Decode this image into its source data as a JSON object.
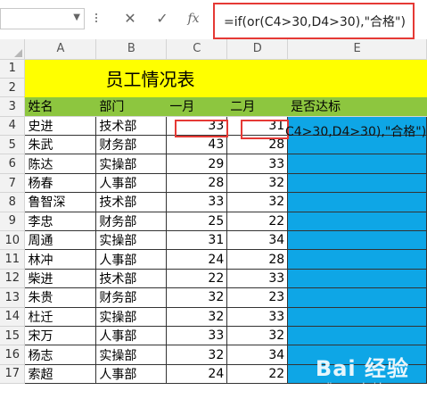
{
  "formula_bar": {
    "name_box": "",
    "cancel_icon": "close-icon",
    "enter_icon": "check-icon",
    "fx_label": "fx",
    "formula": "=if(or(C4>30,D4>30),\"合格\")"
  },
  "columns": [
    "A",
    "B",
    "C",
    "D",
    "E"
  ],
  "rows": [
    "1",
    "2",
    "3",
    "4",
    "5",
    "6",
    "7",
    "8",
    "9",
    "10",
    "11",
    "12",
    "13",
    "14",
    "15",
    "16",
    "17",
    "18"
  ],
  "title": "员工情况表",
  "headers": {
    "name": "姓名",
    "dept": "部门",
    "jan": "一月",
    "feb": "二月",
    "result": "是否达标"
  },
  "records": [
    {
      "name": "史进",
      "dept": "技术部",
      "jan": "33",
      "feb": "31",
      "result": "C4>30,D4>30),\"合格\")"
    },
    {
      "name": "朱武",
      "dept": "财务部",
      "jan": "43",
      "feb": "28",
      "result": ""
    },
    {
      "name": "陈达",
      "dept": "实操部",
      "jan": "29",
      "feb": "33",
      "result": ""
    },
    {
      "name": "杨春",
      "dept": "人事部",
      "jan": "28",
      "feb": "32",
      "result": ""
    },
    {
      "name": "鲁智深",
      "dept": "技术部",
      "jan": "33",
      "feb": "32",
      "result": ""
    },
    {
      "name": "李忠",
      "dept": "财务部",
      "jan": "25",
      "feb": "22",
      "result": ""
    },
    {
      "name": "周通",
      "dept": "实操部",
      "jan": "31",
      "feb": "34",
      "result": ""
    },
    {
      "name": "林冲",
      "dept": "人事部",
      "jan": "24",
      "feb": "28",
      "result": ""
    },
    {
      "name": "柴进",
      "dept": "技术部",
      "jan": "22",
      "feb": "33",
      "result": ""
    },
    {
      "name": "朱贵",
      "dept": "财务部",
      "jan": "32",
      "feb": "23",
      "result": ""
    },
    {
      "name": "杜迁",
      "dept": "实操部",
      "jan": "32",
      "feb": "33",
      "result": ""
    },
    {
      "name": "宋万",
      "dept": "人事部",
      "jan": "33",
      "feb": "32",
      "result": ""
    },
    {
      "name": "杨志",
      "dept": "实操部",
      "jan": "32",
      "feb": "34",
      "result": ""
    },
    {
      "name": "索超",
      "dept": "人事部",
      "jan": "24",
      "feb": "22",
      "result": ""
    }
  ],
  "colors": {
    "title_fill": "#ffff00",
    "header_fill": "#8dc63f",
    "result_fill": "#0ea6e6",
    "highlight": "#e53935"
  },
  "watermark": {
    "logo": "Bai 经验",
    "url": "jingyan.baidu.com"
  }
}
